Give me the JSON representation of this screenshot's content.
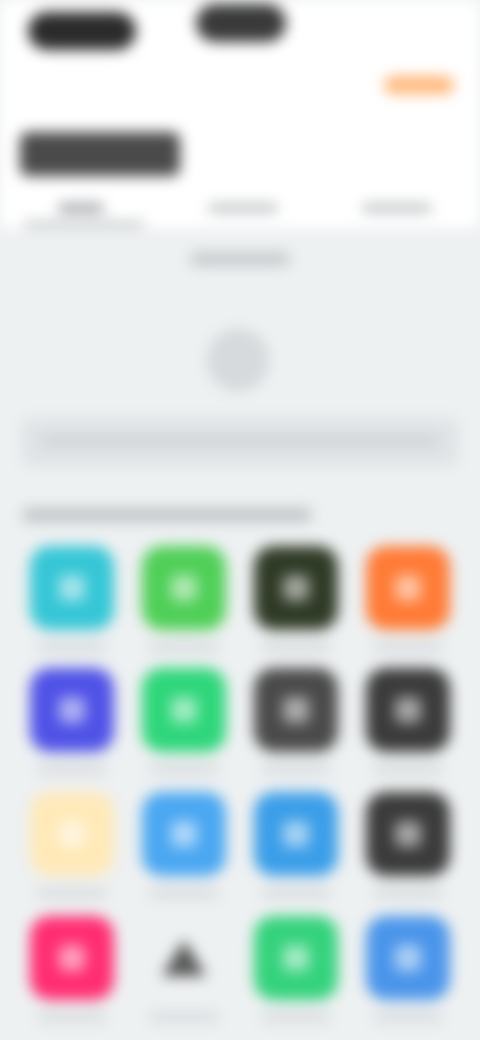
{
  "screen": {
    "note": "",
    "colors": {
      "background": "#eef1f2",
      "header": "#ffffff",
      "accent": "#ff8a2a"
    }
  },
  "header": {
    "pill_left_label": "",
    "pill_right_label": "",
    "accent_button_label": "",
    "title": ""
  },
  "tabs": [
    {
      "label": ""
    },
    {
      "label": ""
    },
    {
      "label": ""
    }
  ],
  "content": {
    "section_label": "",
    "row_text": "",
    "grid_label": ""
  },
  "apps": [
    {
      "icon": "app-icon",
      "color": "#35c6d6",
      "label": ""
    },
    {
      "icon": "app-icon",
      "color": "#4fcf57",
      "label": ""
    },
    {
      "icon": "app-icon",
      "color": "#2f3a26",
      "label": ""
    },
    {
      "icon": "app-icon",
      "color": "#ff7b36",
      "label": ""
    },
    {
      "icon": "app-icon",
      "color": "#4f52e6",
      "label": ""
    },
    {
      "icon": "app-icon",
      "color": "#2ed67a",
      "label": ""
    },
    {
      "icon": "app-icon",
      "color": "#4a4a4a",
      "label": ""
    },
    {
      "icon": "app-icon",
      "color": "#3b3b3b",
      "label": ""
    },
    {
      "icon": "app-icon",
      "color": "#ffe9b8",
      "label": ""
    },
    {
      "icon": "app-icon",
      "color": "#4aa7f1",
      "label": ""
    },
    {
      "icon": "app-icon",
      "color": "#3b9ee8",
      "label": ""
    },
    {
      "icon": "app-icon",
      "color": "#3b3b3b",
      "label": ""
    },
    {
      "icon": "app-icon",
      "color": "#ff2d72",
      "label": ""
    },
    {
      "icon": "triangle-icon",
      "color": "#555555",
      "label": ""
    },
    {
      "icon": "app-icon",
      "color": "#34d27c",
      "label": ""
    },
    {
      "icon": "app-icon",
      "color": "#4a95ea",
      "label": ""
    }
  ]
}
